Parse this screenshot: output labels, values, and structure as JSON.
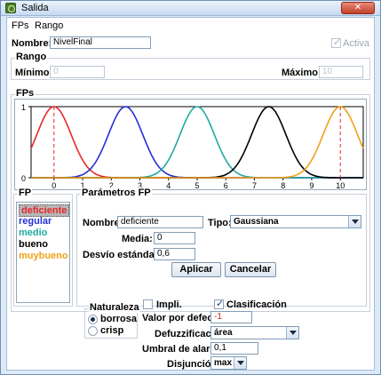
{
  "window": {
    "title": "Salida"
  },
  "menu": {
    "items": [
      "FPs",
      "Rango"
    ]
  },
  "header": {
    "name_label": "Nombre:",
    "name_value": "NivelFinal",
    "active_label": "Activa"
  },
  "range": {
    "title": "Rango",
    "min_label": "Mínimo:",
    "min_value": "0",
    "max_label": "Máximo:",
    "max_value": "10"
  },
  "fps": {
    "title": "FPs"
  },
  "chart_data": {
    "type": "line",
    "title": "",
    "xlabel": "",
    "ylabel": "",
    "xlim": [
      -0.8,
      10.8
    ],
    "ylim": [
      0,
      1
    ],
    "x_ticks": [
      0,
      1,
      2,
      3,
      4,
      5,
      6,
      7,
      8,
      9,
      10
    ],
    "y_ticks": [
      0,
      1
    ],
    "grid": false,
    "series": [
      {
        "name": "deficiente",
        "shape": "gaussian",
        "mean": 0,
        "std": 0.6,
        "color": "#e8262b"
      },
      {
        "name": "regular",
        "shape": "gaussian",
        "mean": 2.5,
        "std": 0.6,
        "color": "#2330d8"
      },
      {
        "name": "medio",
        "shape": "gaussian",
        "mean": 5,
        "std": 0.6,
        "color": "#1faaa0"
      },
      {
        "name": "bueno",
        "shape": "gaussian",
        "mean": 7.5,
        "std": 0.6,
        "color": "#000000"
      },
      {
        "name": "muybueno",
        "shape": "gaussian",
        "mean": 10,
        "std": 0.6,
        "color": "#f0a017"
      }
    ],
    "markers": [
      {
        "x": 0,
        "color": "#e8262b",
        "style": "dashed"
      },
      {
        "x": 10,
        "color": "#e8262b",
        "style": "dashed"
      }
    ]
  },
  "fp_list": {
    "title": "FP",
    "items": [
      {
        "label": "deficiente",
        "color": "#e8262b",
        "selected": true
      },
      {
        "label": "regular",
        "color": "#2330d8",
        "selected": false
      },
      {
        "label": "medio",
        "color": "#1faaa0",
        "selected": false
      },
      {
        "label": "bueno",
        "color": "#000000",
        "selected": false
      },
      {
        "label": "muybueno",
        "color": "#f0a017",
        "selected": false
      }
    ]
  },
  "params": {
    "title": "Parámetros FP",
    "name_label": "Nombre:",
    "name_value": "deficiente",
    "type_label": "Tipo:",
    "type_value": "Gaussiana",
    "mean_label": "Media:",
    "mean_value": "0",
    "std_label": "Desvío estándar:",
    "std_value": "0,6",
    "apply_label": "Aplicar",
    "cancel_label": "Cancelar"
  },
  "nature": {
    "title": "Naturaleza",
    "opt_blurry": "borrosa",
    "opt_crisp": "crisp"
  },
  "options": {
    "impl_label": "Impli.",
    "class_label": "Clasificación",
    "default_label": "Valor por defecto:",
    "default_value": "-1",
    "defuzz_label": "Defuzzificación:",
    "defuzz_value": "área",
    "alarm_label": "Umbral de alarma:",
    "alarm_value": "0,1",
    "disj_label": "Disjunción:",
    "disj_value": "max"
  },
  "colors": {
    "accent": "#3b5f95",
    "default_value_text": "#d02020"
  }
}
